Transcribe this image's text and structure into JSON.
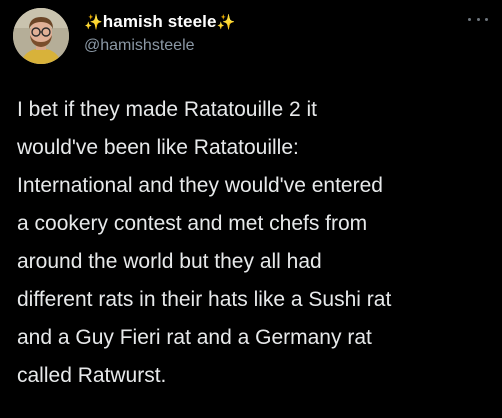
{
  "author": {
    "display_name": "hamish steele",
    "sparkle_left": "✨",
    "sparkle_right": "✨",
    "handle": "@hamishsteele",
    "avatar_icon": "user-avatar-photo"
  },
  "menu": {
    "icon": "more-options-icon"
  },
  "tweet": {
    "lines": [
      "I bet if they made Ratatouille 2 it",
      "would've been like Ratatouille:",
      "International and they would've entered",
      "a cookery contest and met chefs from",
      "around the world but they all had",
      "different rats in their hats like a Sushi rat",
      "and a Guy Fieri rat and a Germany rat",
      "called Ratwurst."
    ]
  },
  "colors": {
    "background": "#000000",
    "text": "#e7e9ea",
    "handle": "#8b98a5",
    "sparkle": "#e8c35a"
  }
}
